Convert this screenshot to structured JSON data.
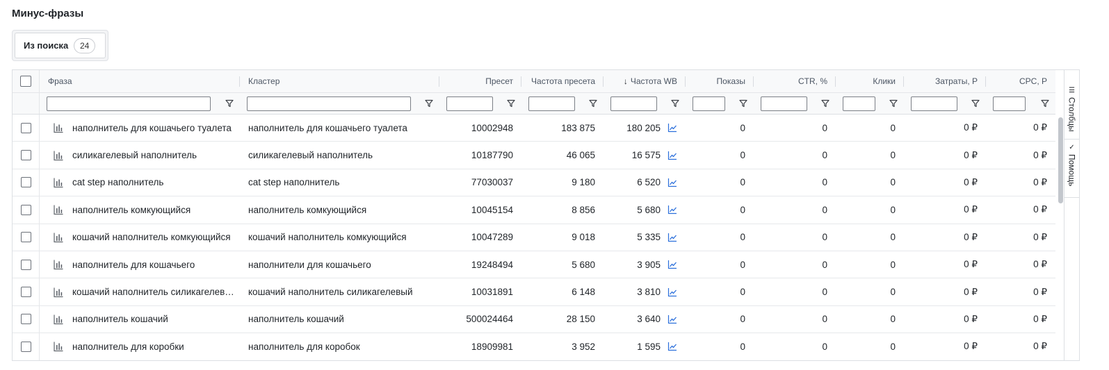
{
  "page": {
    "title": "Минус-фразы"
  },
  "tabs": [
    {
      "label": "Из поиска",
      "count": "24"
    }
  ],
  "columns": {
    "phrase": "Фраза",
    "cluster": "Кластер",
    "preset": "Пресет",
    "preset_freq": "Частота пресета",
    "wb_freq": "Частота WB",
    "shows": "Показы",
    "ctr": "CTR, %",
    "clicks": "Клики",
    "cost": "Затраты, Р",
    "cpc": "CPC, Р"
  },
  "sort": {
    "column": "wb_freq",
    "direction": "desc",
    "icon": "arrow-down-icon"
  },
  "rows": [
    {
      "phrase": "наполнитель для кошачьего туалета",
      "cluster": "наполнитель для кошачьего туалета",
      "preset": "10002948",
      "preset_freq": "183 875",
      "wb_freq": "180 205",
      "shows": "0",
      "ctr": "0",
      "clicks": "0",
      "cost": "0 ₽",
      "cpc": "0 ₽"
    },
    {
      "phrase": "силикагелевый наполнитель",
      "cluster": "силикагелевый наполнитель",
      "preset": "10187790",
      "preset_freq": "46 065",
      "wb_freq": "16 575",
      "shows": "0",
      "ctr": "0",
      "clicks": "0",
      "cost": "0 ₽",
      "cpc": "0 ₽"
    },
    {
      "phrase": "cat step наполнитель",
      "cluster": "cat step наполнитель",
      "preset": "77030037",
      "preset_freq": "9 180",
      "wb_freq": "6 520",
      "shows": "0",
      "ctr": "0",
      "clicks": "0",
      "cost": "0 ₽",
      "cpc": "0 ₽"
    },
    {
      "phrase": "наполнитель комкующийся",
      "cluster": "наполнитель комкующийся",
      "preset": "10045154",
      "preset_freq": "8 856",
      "wb_freq": "5 680",
      "shows": "0",
      "ctr": "0",
      "clicks": "0",
      "cost": "0 ₽",
      "cpc": "0 ₽"
    },
    {
      "phrase": "кошачий наполнитель комкующийся",
      "cluster": "кошачий наполнитель комкующийся",
      "preset": "10047289",
      "preset_freq": "9 018",
      "wb_freq": "5 335",
      "shows": "0",
      "ctr": "0",
      "clicks": "0",
      "cost": "0 ₽",
      "cpc": "0 ₽"
    },
    {
      "phrase": "наполнитель для кошачьего",
      "cluster": "наполнители для кошачьего",
      "preset": "19248494",
      "preset_freq": "5 680",
      "wb_freq": "3 905",
      "shows": "0",
      "ctr": "0",
      "clicks": "0",
      "cost": "0 ₽",
      "cpc": "0 ₽"
    },
    {
      "phrase": "кошачий наполнитель силикагелевый",
      "cluster": "кошачий наполнитель силикагелевый",
      "preset": "10031891",
      "preset_freq": "6 148",
      "wb_freq": "3 810",
      "shows": "0",
      "ctr": "0",
      "clicks": "0",
      "cost": "0 ₽",
      "cpc": "0 ₽"
    },
    {
      "phrase": "наполнитель кошачий",
      "cluster": "наполнитель кошачий",
      "preset": "500024464",
      "preset_freq": "28 150",
      "wb_freq": "3 640",
      "shows": "0",
      "ctr": "0",
      "clicks": "0",
      "cost": "0 ₽",
      "cpc": "0 ₽"
    },
    {
      "phrase": "наполнитель для коробки",
      "cluster": "наполнитель для коробок",
      "preset": "18909981",
      "preset_freq": "3 952",
      "wb_freq": "1 595",
      "shows": "0",
      "ctr": "0",
      "clicks": "0",
      "cost": "0 ₽",
      "cpc": "0 ₽"
    }
  ],
  "side_panel": {
    "columns_label": "Столбцы",
    "help_label": "Помощь"
  },
  "icons": {
    "row_stats": "bar-chart-icon",
    "wb_trend": "trend-line-icon",
    "filter": "filter-icon",
    "columns": "columns-icon",
    "help": "check-icon"
  },
  "colors": {
    "accent": "#2b6fdb",
    "border": "#dcdfe3",
    "header_bg": "#f8f9fa"
  }
}
